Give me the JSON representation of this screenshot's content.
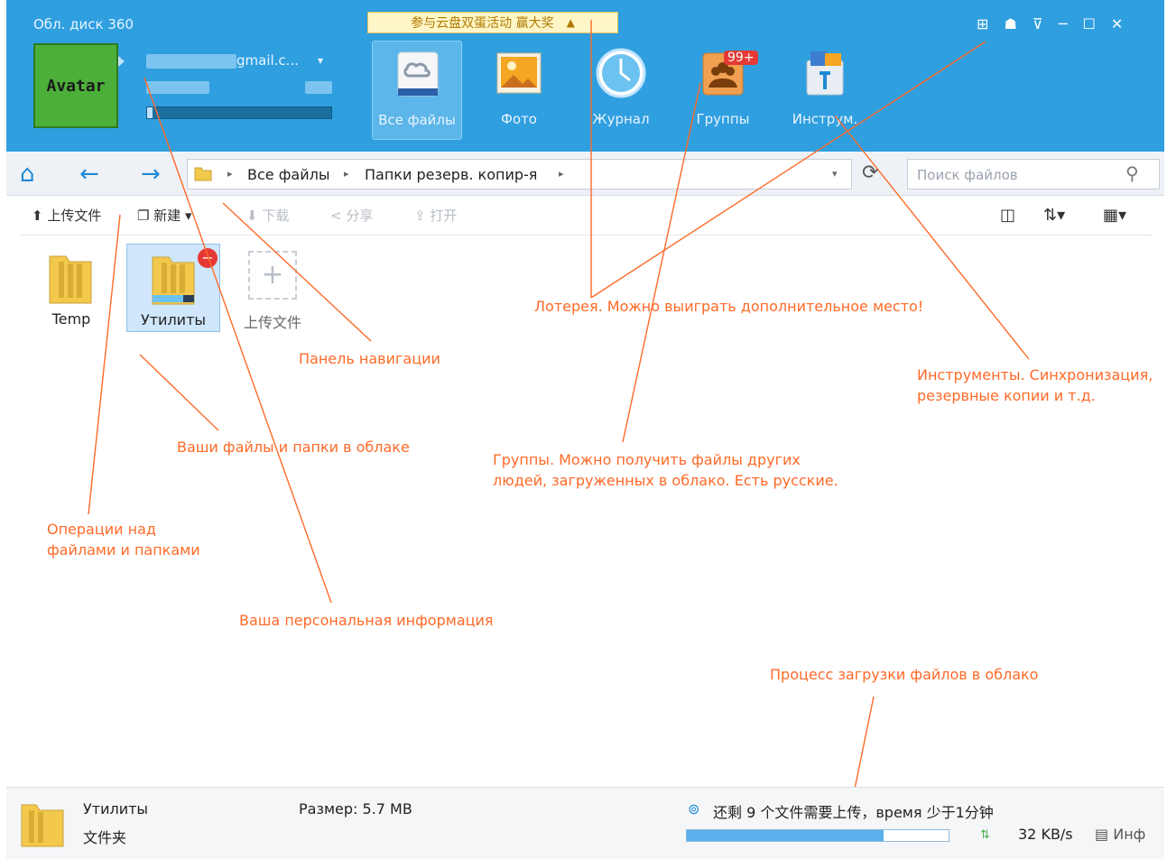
{
  "header": {
    "app_title": "Обл. диск 360",
    "avatar_text": "Avatar",
    "email_suffix": "gmail.c...",
    "dropdown": "▾",
    "lottery_text": "参与云盘双蛋活动 赢大奖",
    "nav": [
      {
        "label": "Все файлы",
        "icon": "cloud-icon"
      },
      {
        "label": "Фото",
        "icon": "photo-icon"
      },
      {
        "label": "Журнал",
        "icon": "clock-icon"
      },
      {
        "label": "Группы",
        "icon": "group-icon"
      },
      {
        "label": "Инструм.",
        "icon": "tools-icon"
      }
    ],
    "groups_badge": "99+",
    "window_controls": "⊞ ☗ ⊽ ─ ☐ ✕",
    "quota_fraction": 0.03
  },
  "toolbar": {
    "breadcrumb": [
      "Все файлы",
      "Папки резерв. копир-я"
    ],
    "search_placeholder": "Поиск файлов"
  },
  "actions": {
    "upload": "上传文件",
    "new": "新建",
    "download": "下载",
    "share": "分享",
    "open": "打开"
  },
  "files": [
    {
      "name": "Temp"
    },
    {
      "name": "Утилиты"
    },
    {
      "name": "上传文件"
    }
  ],
  "annotations": {
    "lottery": "Лотерея. Можно выиграть дополнительное место!",
    "navigation": "Панель навигации",
    "tools": [
      "Инструменты. Синхронизация,",
      "резервные копии и т.д."
    ],
    "files": "Ваши файлы и папки в облаке",
    "groups": [
      "Группы. Можно получить файлы других",
      "людей, загруженных в облако. Есть русские."
    ],
    "operations": [
      "Операции над",
      "файлами и папками"
    ],
    "personal": "Ваша персональная информация",
    "upload": "Процесс загрузки файлов в облако"
  },
  "status": {
    "name": "Утилиты",
    "type": "文件夹",
    "size": "Размер: 5.7 MB",
    "upload_msg": "还剩 9 个文件需要上传，время 少于1分钟",
    "speed": "32 KB/s",
    "info": "Инф",
    "upload_fraction": 0.75
  },
  "colors": {
    "header": "#2f9fe0",
    "annotation": "#ff6a28"
  }
}
